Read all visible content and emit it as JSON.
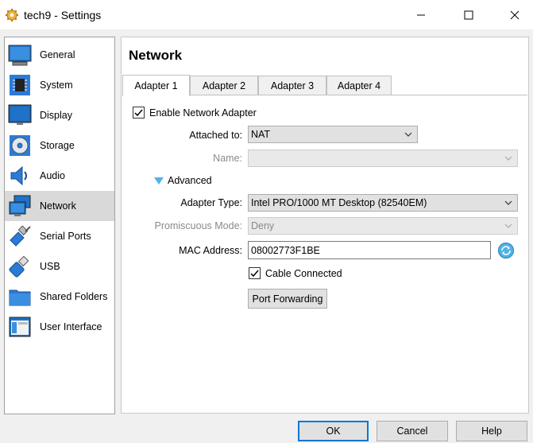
{
  "window": {
    "title": "tech9 - Settings"
  },
  "sidebar": {
    "items": [
      {
        "label": "General",
        "icon": "general-icon"
      },
      {
        "label": "System",
        "icon": "chip-icon"
      },
      {
        "label": "Display",
        "icon": "monitor-icon"
      },
      {
        "label": "Storage",
        "icon": "disk-icon"
      },
      {
        "label": "Audio",
        "icon": "speaker-icon"
      },
      {
        "label": "Network",
        "icon": "network-icon"
      },
      {
        "label": "Serial Ports",
        "icon": "serial-port-icon"
      },
      {
        "label": "USB",
        "icon": "usb-icon"
      },
      {
        "label": "Shared Folders",
        "icon": "folder-icon"
      },
      {
        "label": "User Interface",
        "icon": "ui-icon"
      }
    ],
    "selected": "Network"
  },
  "page": {
    "title": "Network",
    "tabs": [
      "Adapter 1",
      "Adapter 2",
      "Adapter 3",
      "Adapter 4"
    ],
    "active_tab": "Adapter 1"
  },
  "adapter": {
    "enable_label": "Enable Network Adapter",
    "enabled": true,
    "attached_label": "Attached to:",
    "attached_value": "NAT",
    "name_label": "Name:",
    "name_value": "",
    "advanced_label": "Advanced",
    "adapter_type_label": "Adapter Type:",
    "adapter_type_value": "Intel PRO/1000 MT Desktop (82540EM)",
    "promiscuous_label": "Promiscuous Mode:",
    "promiscuous_value": "Deny",
    "mac_label": "MAC Address:",
    "mac_value": "08002773F1BE",
    "cable_label": "Cable Connected",
    "cable_connected": true,
    "port_forwarding_label": "Port Forwarding"
  },
  "buttons": {
    "ok": "OK",
    "cancel": "Cancel",
    "help": "Help"
  },
  "colors": {
    "accent": "#0078d7",
    "selection": "#d9d9d9",
    "monitor_blue": "#1e72c8"
  }
}
